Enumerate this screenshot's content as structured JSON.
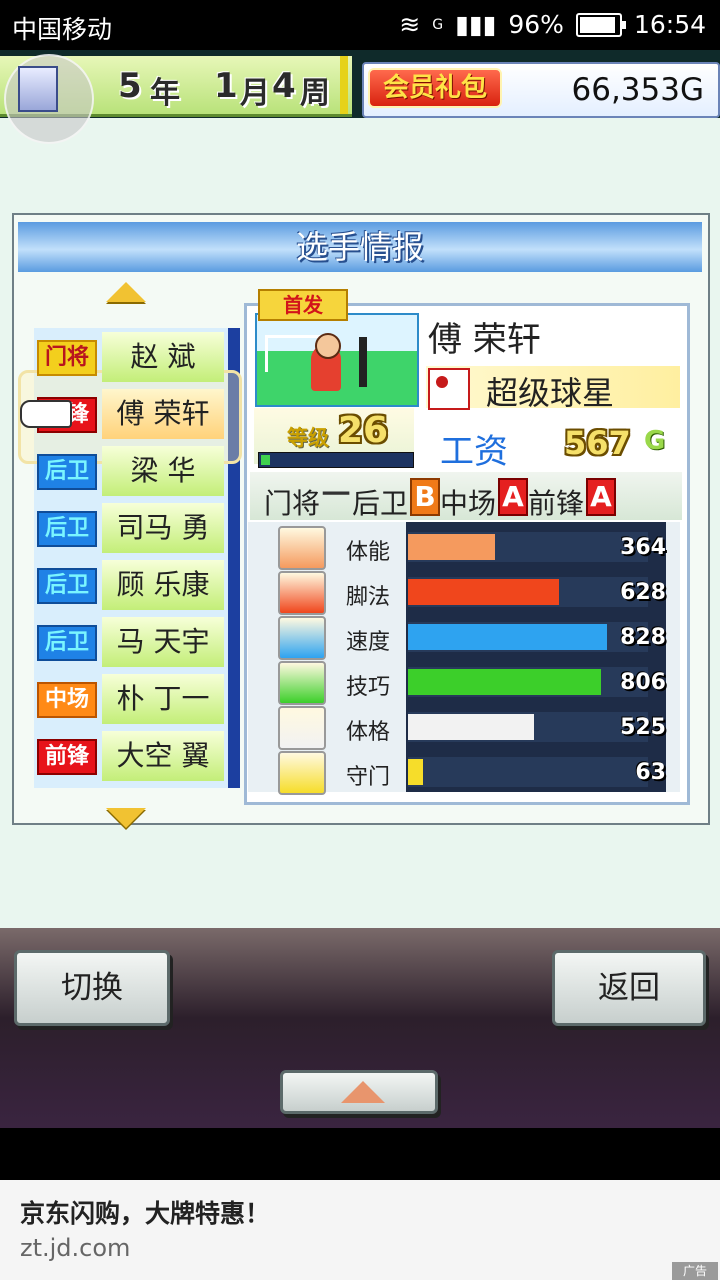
{
  "status_bar": {
    "carrier": "中国移动",
    "network": "G",
    "battery": "96%",
    "battery_level": 0.96,
    "time": "16:54"
  },
  "header": {
    "year": "5",
    "year_unit": "年",
    "month": "1",
    "month_unit": "月",
    "week": "4",
    "week_unit": "周",
    "member_pack": "会员礼包",
    "money": "66,353G"
  },
  "panel": {
    "title": "选手情报",
    "players": [
      {
        "position": "门将",
        "pos_class": "gk",
        "name": "赵 斌"
      },
      {
        "position": "前锋",
        "pos_class": "fw",
        "name": "傅 荣轩",
        "selected": true
      },
      {
        "position": "后卫",
        "pos_class": "df",
        "name": "梁 华"
      },
      {
        "position": "后卫",
        "pos_class": "df",
        "name": "司马 勇"
      },
      {
        "position": "后卫",
        "pos_class": "df",
        "name": "顾 乐康"
      },
      {
        "position": "后卫",
        "pos_class": "df",
        "name": "马 天宇"
      },
      {
        "position": "中场",
        "pos_class": "mf",
        "name": "朴 丁一"
      },
      {
        "position": "前锋",
        "pos_class": "fw",
        "name": "大空 翼"
      }
    ]
  },
  "detail": {
    "starter_badge": "首发",
    "name": "傅 荣轩",
    "title": "超级球星",
    "level_label": "等级",
    "level": "26",
    "exp_fraction": 0.06,
    "salary_label": "工资",
    "salary": "567",
    "salary_unit": "G",
    "aptitudes": [
      {
        "label": "门将",
        "grade": "一"
      },
      {
        "label": "后卫",
        "grade": "B"
      },
      {
        "label": "中场",
        "grade": "A"
      },
      {
        "label": "前锋",
        "grade": "A"
      }
    ],
    "stats": [
      {
        "label": "体能",
        "value": "364",
        "fraction": 0.364,
        "color": "#f59a5e",
        "icon": "battery-icon"
      },
      {
        "label": "脚法",
        "value": "628",
        "fraction": 0.628,
        "color": "#f0461c",
        "icon": "boot-icon"
      },
      {
        "label": "速度",
        "value": "828",
        "fraction": 0.828,
        "color": "#2ea3f0",
        "icon": "running-icon"
      },
      {
        "label": "技巧",
        "value": "806",
        "fraction": 0.806,
        "color": "#3ccf2a",
        "icon": "dribble-icon"
      },
      {
        "label": "体格",
        "value": "525",
        "fraction": 0.525,
        "color": "#f2f2f2",
        "icon": "muscle-icon"
      },
      {
        "label": "守门",
        "value": "63",
        "fraction": 0.063,
        "color": "#f6dd2a",
        "icon": "glove-icon"
      }
    ]
  },
  "buttons": {
    "switch": "切换",
    "back": "返回"
  },
  "ad": {
    "title": "京东闪购，大牌特惠！",
    "url": "zt.jd.com",
    "tag": "广告"
  }
}
